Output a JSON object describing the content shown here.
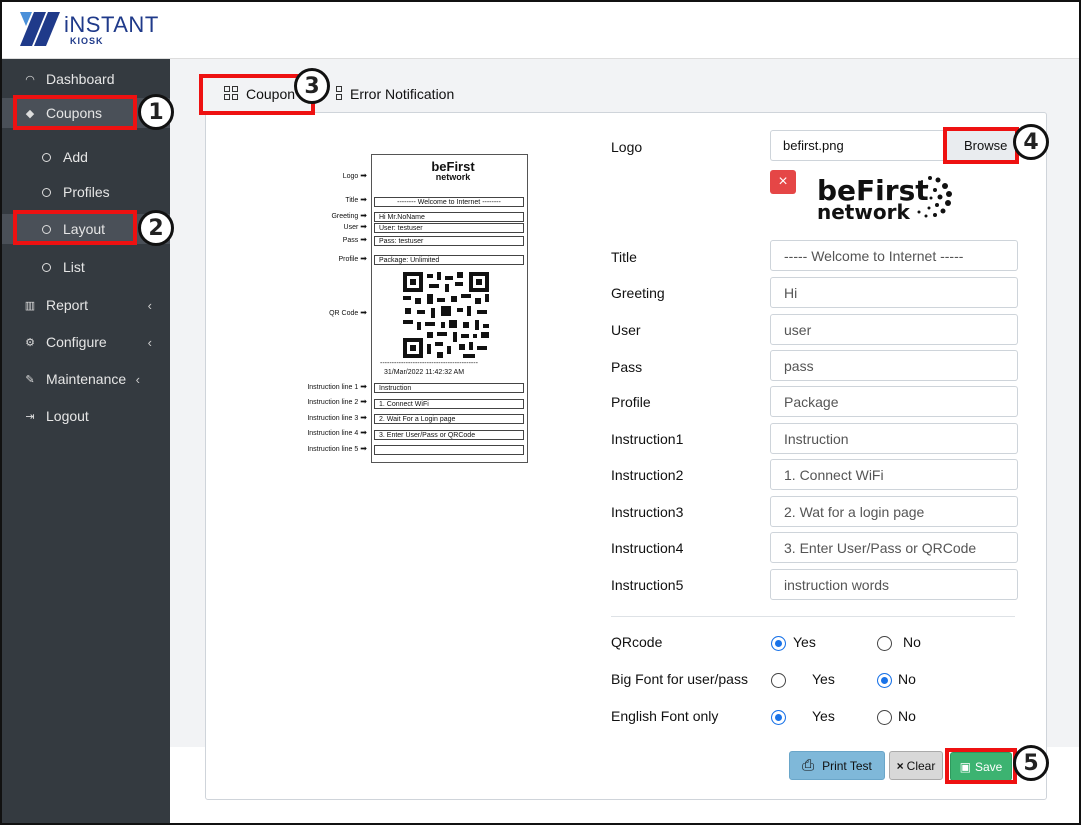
{
  "brand": {
    "name": "iNSTANT",
    "sub": "KIOSK"
  },
  "sidebar": {
    "dashboard": "Dashboard",
    "coupons": "Coupons",
    "add": "Add",
    "profiles": "Profiles",
    "layout": "Layout",
    "list": "List",
    "report": "Report",
    "configure": "Configure",
    "maintenance": "Maintenance",
    "logout": "Logout"
  },
  "tabs": {
    "coupon": "Coupon",
    "error": "Error Notification"
  },
  "callouts": [
    "1",
    "2",
    "3",
    "4",
    "5"
  ],
  "preview": {
    "logo_text": "beFirst",
    "logo_sub": "network",
    "title": "-------- Welcome to Internet --------",
    "greeting": "Hi Mr.NoName",
    "user": "User: testuser",
    "pass": "Pass: testuser",
    "profile": "Package: Unlimited",
    "dashes": "------------------------------------------",
    "datetime": "31/Mar/2022 11:42:32 AM",
    "instr1": "Instruction",
    "instr2": "1. Connect WiFi",
    "instr3": "2. Wait For a Login page",
    "instr4": "3. Enter User/Pass or QRCode",
    "instr5": "",
    "labels": {
      "logo": "Logo",
      "title": "Title",
      "greeting": "Greeting",
      "user": "User",
      "pass": "Pass",
      "profile": "Profile",
      "qr": "QR Code",
      "il1": "Instruction line 1",
      "il2": "Instruction line 2",
      "il3": "Instruction line 3",
      "il4": "Instruction line 4",
      "il5": "Instruction line 5"
    }
  },
  "form": {
    "logo_label": "Logo",
    "logo_file": "befirst.png",
    "browse": "Browse",
    "delete": "×",
    "logo_preview": "beFirst",
    "logo_preview_sub": "network",
    "title_label": "Title",
    "title_value": "----- Welcome to Internet -----",
    "greeting_label": "Greeting",
    "greeting_value": "Hi",
    "user_label": "User",
    "user_value": "user",
    "pass_label": "Pass",
    "pass_value": "pass",
    "profile_label": "Profile",
    "profile_value": "Package",
    "instr1_label": "Instruction1",
    "instr1_value": "Instruction",
    "instr2_label": "Instruction2",
    "instr2_value": "1. Connect WiFi",
    "instr3_label": "Instruction3",
    "instr3_value": "2. Wat for a login page",
    "instr4_label": "Instruction4",
    "instr4_value": "3. Enter User/Pass or QRCode",
    "instr5_label": "Instruction5",
    "instr5_value": "instruction words",
    "qrcode_label": "QRcode",
    "bigfont_label": "Big Font for user/pass",
    "english_label": "English Font only",
    "yes": "Yes",
    "no": "No",
    "qrcode_selected": "Yes",
    "bigfont_selected": "No",
    "english_selected": "Yes"
  },
  "buttons": {
    "print": "Print Test",
    "clear": "Clear",
    "clear_icon": "×",
    "save": "Save"
  },
  "colors": {
    "sidebar": "#343a40",
    "highlight": "#e11111",
    "radio": "#1a73e8",
    "save": "#3cb371",
    "print": "#7fb8d9"
  }
}
